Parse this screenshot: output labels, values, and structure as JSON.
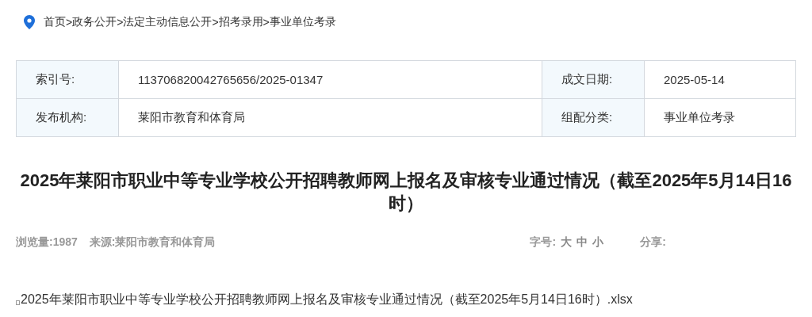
{
  "breadcrumb": {
    "separator": ">",
    "items": [
      "首页",
      "政务公开",
      "法定主动信息公开",
      "招考录用",
      "事业单位考录"
    ]
  },
  "info_table": {
    "rows": [
      [
        {
          "label": "索引号:",
          "value": "113706820042765656/2025-01347"
        },
        {
          "label": "成文日期:",
          "value": "2025-05-14"
        }
      ],
      [
        {
          "label": "发布机构:",
          "value": "莱阳市教育和体育局"
        },
        {
          "label": "组配分类:",
          "value": "事业单位考录"
        }
      ]
    ]
  },
  "title": "2025年莱阳市职业中等专业学校公开招聘教师网上报名及审核专业通过情况（截至2025年5月14日16时）",
  "meta": {
    "views": "浏览量:1987",
    "source": "来源:莱阳市教育和体育局",
    "font_size_label": "字号:",
    "font_sizes": [
      "大",
      "中",
      "小"
    ],
    "share_label": "分享:"
  },
  "attachment": {
    "name": "2025年莱阳市职业中等专业学校公开招聘教师网上报名及审核专业通过情况（截至2025年5月14日16时）.xlsx"
  }
}
